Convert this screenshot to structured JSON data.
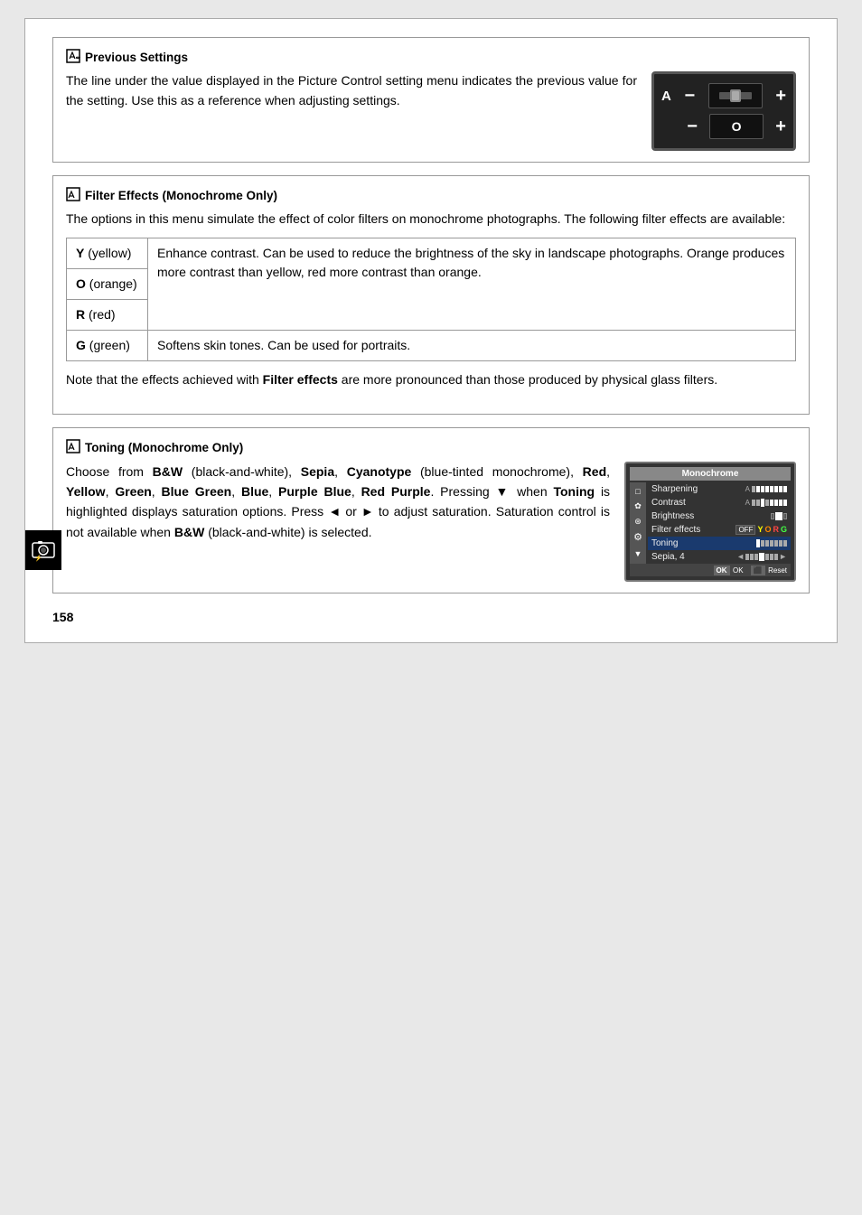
{
  "page": {
    "number": "158"
  },
  "previous_settings": {
    "title": "Previous Settings",
    "body": "The line under the value displayed in the Picture Control setting menu indicates the previous value for the setting. Use this as a reference when adjusting settings."
  },
  "filter_effects": {
    "title": "Filter Effects (Monochrome Only)",
    "intro": "The options in this menu simulate the effect of color filters on monochrome photographs. The following filter effects are available:",
    "rows": [
      {
        "key": "Y (yellow)",
        "value": "Enhance contrast. Can be used to reduce the brightness of the sky in landscape photographs. Orange produces more contrast than yellow, red more contrast than orange."
      },
      {
        "key": "O (orange)",
        "value": ""
      },
      {
        "key": "R (red)",
        "value": ""
      },
      {
        "key": "G (green)",
        "value": "Softens skin tones. Can be used for portraits."
      }
    ],
    "note": "Note that the effects achieved with Filter effects are more pronounced than those produced by physical glass filters."
  },
  "toning": {
    "title": "Toning (Monochrome Only)",
    "body_parts": [
      "Choose from ",
      "B&W",
      " (black-and-white), ",
      "Sepia",
      ", ",
      "Cyanotype",
      " (blue-tinted monochrome), ",
      "Red",
      ", ",
      "Yellow",
      ", ",
      "Green",
      ", ",
      "Blue Green",
      ", ",
      "Blue",
      ", ",
      "Purple Blue",
      ", ",
      "Red Purple",
      ". Pressing ▼ when ",
      "Toning",
      " is highlighted displays saturation options. Press ◄ or ► to adjust saturation. Saturation control is not available when ",
      "B&W",
      " (black-and-white) is selected."
    ]
  },
  "menu_screen": {
    "title": "Monochrome",
    "rows": [
      {
        "label": "Sharpening",
        "value": "A [bar]",
        "highlighted": false
      },
      {
        "label": "Contrast",
        "value": "A [bar-center]",
        "highlighted": false
      },
      {
        "label": "Brightness",
        "value": "[box]",
        "highlighted": false
      },
      {
        "label": "Filter effects",
        "value": "OFF Y O R G",
        "highlighted": false
      },
      {
        "label": "Toning",
        "value": "[bar-left]",
        "highlighted": true
      },
      {
        "label": "Sepia, 4",
        "value": "[arrow-bar]",
        "highlighted": false
      }
    ],
    "footer": [
      "OK OK",
      "Reset"
    ]
  },
  "camera_display": {
    "row1": {
      "left": "A",
      "minus": "−",
      "center": "",
      "plus": "+"
    },
    "row2": {
      "left": "",
      "minus": "−",
      "center": "O",
      "plus": "+"
    }
  }
}
